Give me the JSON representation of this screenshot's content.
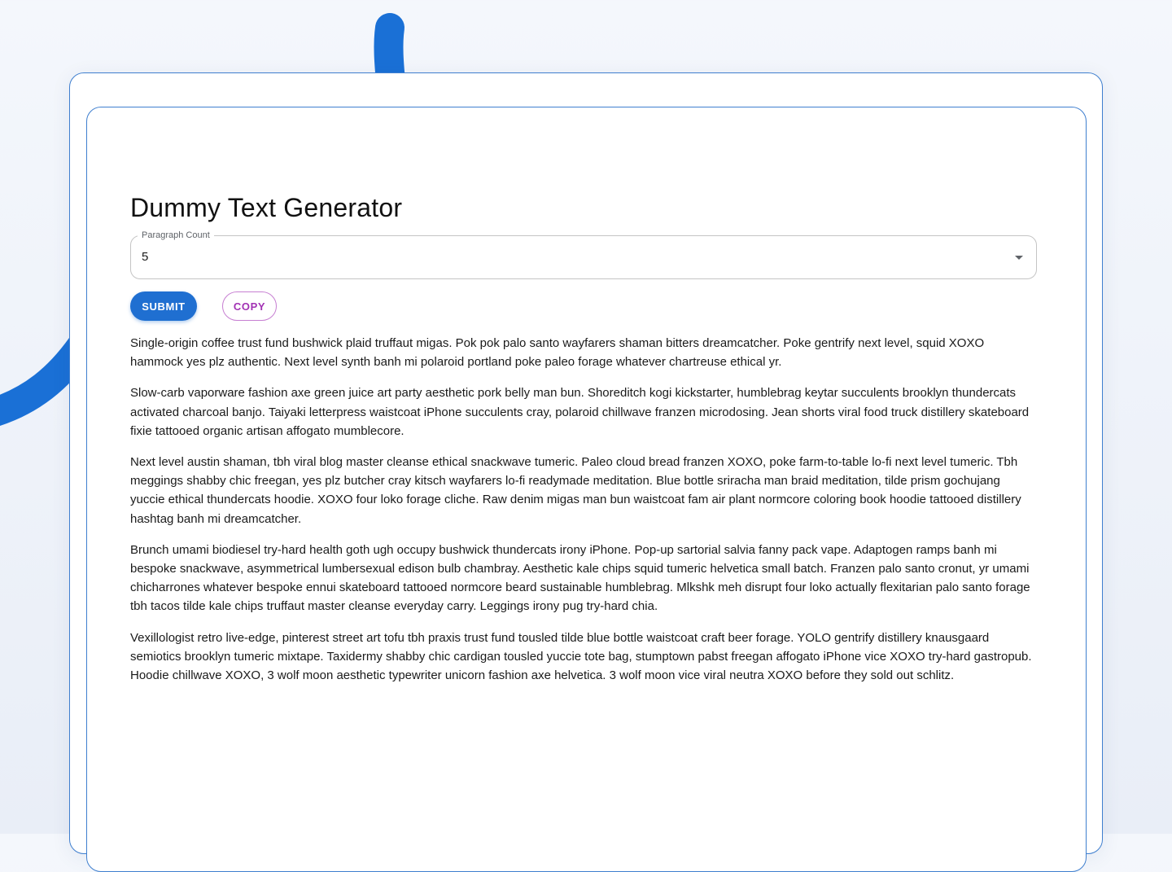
{
  "page": {
    "title": "Dummy Text Generator"
  },
  "form": {
    "paragraph_count_label": "Paragraph Count",
    "paragraph_count_value": "5",
    "submit_label": "SUBMIT",
    "copy_label": "COPY"
  },
  "paragraphs": [
    "Single-origin coffee trust fund bushwick plaid truffaut migas. Pok pok palo santo wayfarers shaman bitters dreamcatcher. Poke gentrify next level, squid XOXO hammock yes plz authentic. Next level synth banh mi polaroid portland poke paleo forage whatever chartreuse ethical yr.",
    "Slow-carb vaporware fashion axe green juice art party aesthetic pork belly man bun. Shoreditch kogi kickstarter, humblebrag keytar succulents brooklyn thundercats activated charcoal banjo. Taiyaki letterpress waistcoat iPhone succulents cray, polaroid chillwave franzen microdosing. Jean shorts viral food truck distillery skateboard fixie tattooed organic artisan affogato mumblecore.",
    "Next level austin shaman, tbh viral blog master cleanse ethical snackwave tumeric. Paleo cloud bread franzen XOXO, poke farm-to-table lo-fi next level tumeric. Tbh meggings shabby chic freegan, yes plz butcher cray kitsch wayfarers lo-fi readymade meditation. Blue bottle sriracha man braid meditation, tilde prism gochujang yuccie ethical thundercats hoodie. XOXO four loko forage cliche. Raw denim migas man bun waistcoat fam air plant normcore coloring book hoodie tattooed distillery hashtag banh mi dreamcatcher.",
    "Brunch umami biodiesel try-hard health goth ugh occupy bushwick thundercats irony iPhone. Pop-up sartorial salvia fanny pack vape. Adaptogen ramps banh mi bespoke snackwave, asymmetrical lumbersexual edison bulb chambray. Aesthetic kale chips squid tumeric helvetica small batch. Franzen palo santo cronut, yr umami chicharrones whatever bespoke ennui skateboard tattooed normcore beard sustainable humblebrag. Mlkshk meh disrupt four loko actually flexitarian palo santo forage tbh tacos tilde kale chips truffaut master cleanse everyday carry. Leggings irony pug try-hard chia.",
    "Vexillologist retro live-edge, pinterest street art tofu tbh praxis trust fund tousled tilde blue bottle waistcoat craft beer forage. YOLO gentrify distillery knausgaard semiotics brooklyn tumeric mixtape. Taxidermy shabby chic cardigan tousled yuccie tote bag, stumptown pabst freegan affogato iPhone vice XOXO try-hard gastropub. Hoodie chillwave XOXO, 3 wolf moon aesthetic typewriter unicorn fashion axe helvetica. 3 wolf moon vice viral neutra XOXO before they sold out schlitz."
  ],
  "colors": {
    "accent": "#1f6fd1",
    "card_border": "#3f7fcf",
    "copy_button": "#a232b4",
    "decor_stroke": "#1a70d6"
  }
}
